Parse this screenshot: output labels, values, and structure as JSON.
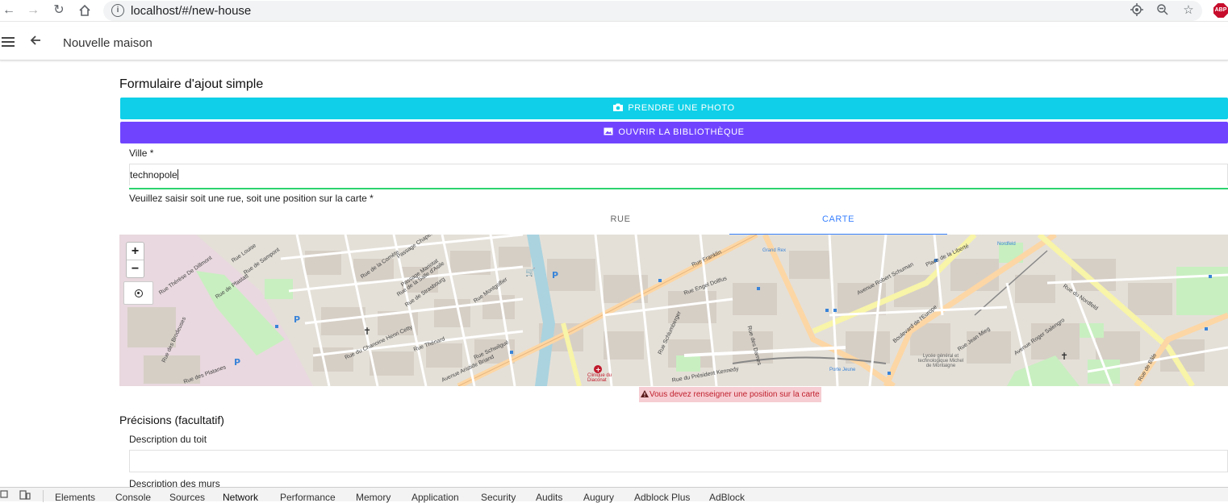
{
  "browser": {
    "url": "localhost/#/new-house",
    "abp_label": "ABP"
  },
  "header": {
    "title": "Nouvelle maison"
  },
  "form": {
    "title": "Formulaire d'ajout simple",
    "photo_button": "PRENDRE UNE PHOTO",
    "library_button": "OUVRIR LA BIBLIOTHÈQUE",
    "ville_label": "Ville *",
    "ville_value": "technopole",
    "position_label": "Veuillez saisir soit une rue, soit une position sur la carte *",
    "segments": [
      {
        "label": "RUE",
        "active": false
      },
      {
        "label": "CARTE",
        "active": true
      }
    ],
    "error": "Vous devez renseigner une position sur la carte",
    "precisions_title": "Précisions (facultatif)",
    "toit_label": "Description du toit",
    "murs_label": "Description des murs"
  },
  "map": {
    "zoom_in": "+",
    "zoom_out": "−",
    "labels": [
      "Rue Thérèse De Dillmont",
      "Rue de Pfastatt",
      "Rue de Sampont",
      "Rue Louise",
      "Passage Chapelle",
      "Rue de la Comète",
      "Passage Mariotat",
      "Rue de la Salle d'Asile",
      "Rue de Strasbourg",
      "Rue Thénard",
      "Rue du Chanoine Henri Cetty",
      "Rue Schwilgué",
      "Rue Montgolfier",
      "Rue Franklin",
      "Avenue Aristide Briand",
      "Rue Engel Dollfus",
      "Rue Schlumberger",
      "Rue du Président Kennedy",
      "Clinique du Diaconat",
      "Avenue Robert Schuman",
      "Boulevard de l'Europe",
      "Place de la Liberté",
      "Rue du Nordfeld",
      "Nordfeld",
      "Porte Jeune",
      "Lycée général et technologique Michel de Montaigne",
      "Avenue Roger Salengro",
      "Rue de Bâle",
      "Rue des Platanes",
      "Rue des Brodeuses",
      "Rue Jean Mieg",
      "Rue des Dames",
      "Grand Rex"
    ]
  },
  "devtools": {
    "tabs": [
      "Elements",
      "Console",
      "Sources",
      "Network",
      "Performance",
      "Memory",
      "Application",
      "Security",
      "Audits",
      "Augury",
      "Adblock Plus",
      "AdBlock"
    ],
    "active": "Network"
  },
  "colors": {
    "photo_button": "#0fd0e8",
    "library_button": "#7044ff",
    "active_segment": "#3880ff",
    "valid_line": "#2dd36f",
    "error_bg": "#f6cdd2",
    "error_text": "#c01f2d"
  }
}
